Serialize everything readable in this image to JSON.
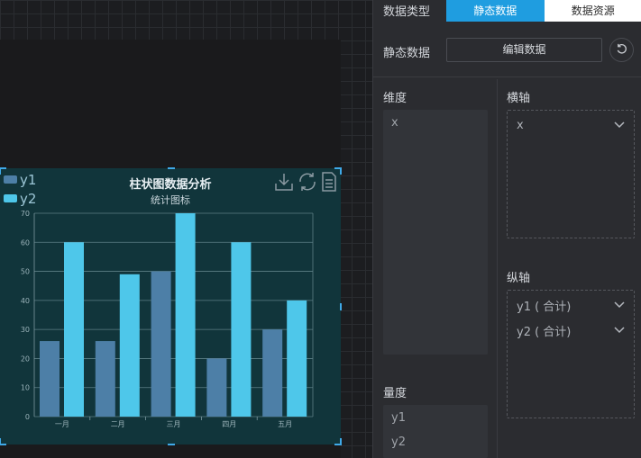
{
  "panel": {
    "data_type_label": "数据类型",
    "data_type_options": [
      "静态数据",
      "数据资源"
    ],
    "static_data_label": "静态数据",
    "edit_button": "编辑数据",
    "dimension_label": "维度",
    "dimension_fields": [
      "x"
    ],
    "measure_label": "量度",
    "measure_fields": [
      "y1",
      "y2"
    ],
    "x_axis_label": "横轴",
    "x_axis_items": [
      "x"
    ],
    "y_axis_label": "纵轴",
    "y_axis_items": [
      "y1 ( 合计)",
      "y2 ( 合计)"
    ]
  },
  "chart_data": {
    "type": "bar",
    "title": "柱状图数据分析",
    "subtitle": "统计图标",
    "categories": [
      "一月",
      "二月",
      "三月",
      "四月",
      "五月"
    ],
    "series": [
      {
        "name": "y1",
        "values": [
          26,
          26,
          50,
          20,
          30
        ],
        "color": "#4d7fa7"
      },
      {
        "name": "y2",
        "values": [
          60,
          49,
          70,
          60,
          40
        ],
        "color": "#4ec7ea"
      }
    ],
    "ylim": [
      0,
      70
    ],
    "yticks": [
      0,
      10,
      20,
      30,
      40,
      50,
      60,
      70
    ],
    "legend": "top-left",
    "grid": true
  },
  "colors": {
    "accent": "#1f9de0",
    "chart_bg": "#11353b",
    "selection": "#3fa9e8"
  },
  "icons": {
    "download": "download-icon",
    "refresh": "refresh-icon",
    "data_view": "data-view-icon"
  }
}
